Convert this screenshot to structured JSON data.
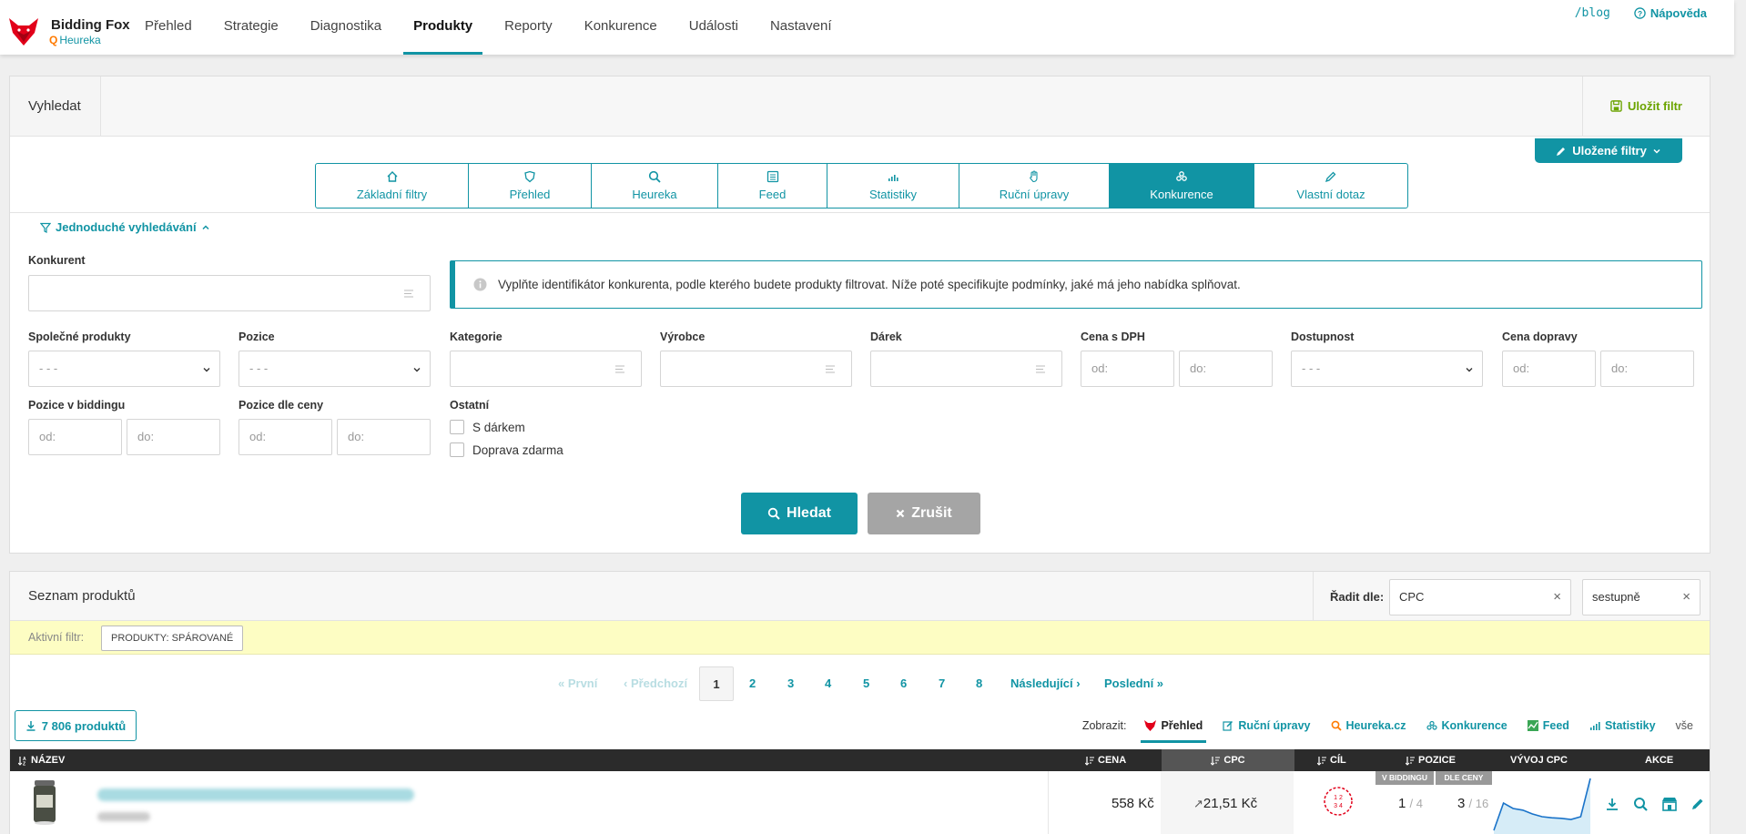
{
  "app": {
    "name": "Bidding Fox",
    "sub": "Heureka"
  },
  "nav": [
    {
      "label": "Přehled"
    },
    {
      "label": "Strategie"
    },
    {
      "label": "Diagnostika"
    },
    {
      "label": "Produkty"
    },
    {
      "label": "Reporty"
    },
    {
      "label": "Konkurence"
    },
    {
      "label": "Události"
    },
    {
      "label": "Nastavení"
    }
  ],
  "top_right": {
    "blog": "/blog",
    "help": "Nápověda"
  },
  "search": {
    "title": "Vyhledat",
    "save_filter": "Uložit filtr",
    "saved_filters": "Uložené filtry",
    "tabs": [
      {
        "label": "Základní filtry"
      },
      {
        "label": "Přehled"
      },
      {
        "label": "Heureka"
      },
      {
        "label": "Feed"
      },
      {
        "label": "Statistiky"
      },
      {
        "label": "Ruční úpravy"
      },
      {
        "label": "Konkurence"
      },
      {
        "label": "Vlastní dotaz"
      }
    ],
    "simple": "Jednoduché vyhledávání",
    "competitor_label": "Konkurent",
    "info": "Vyplňte identifikátor konkurenta, podle kterého budete produkty filtrovat. Níže poté specifikujte podmínky, jaké má jeho nabídka splňovat.",
    "labels": {
      "common": "Společné produkty",
      "position": "Pozice",
      "category": "Kategorie",
      "maker": "Výrobce",
      "gift": "Dárek",
      "price_vat": "Cena s DPH",
      "availability": "Dostupnost",
      "shipping": "Cena dopravy",
      "pos_bidding": "Pozice v biddingu",
      "pos_price": "Pozice dle ceny",
      "other": "Ostatní"
    },
    "select_placeholder": "- - -",
    "from": "od:",
    "to": "do:",
    "checkbox_gift": "S dárkem",
    "checkbox_free": "Doprava zdarma",
    "btn_search": "Hledat",
    "btn_cancel": "Zrušit"
  },
  "list": {
    "title": "Seznam produktů",
    "sort_label": "Řadit dle:",
    "sort_by": "CPC",
    "sort_dir": "sestupně",
    "active_filter_label": "Aktivní filtr:",
    "active_filter_tag": "PRODUKTY: SPÁROVANÉ",
    "pager": {
      "first": "První",
      "prev": "Předchozí",
      "pages": [
        "1",
        "2",
        "3",
        "4",
        "5",
        "6",
        "7",
        "8"
      ],
      "next": "Následující",
      "last": "Poslední"
    },
    "count": "7 806 produktů",
    "show_label": "Zobrazit:",
    "show": [
      "Přehled",
      "Ruční úpravy",
      "Heureka.cz",
      "Konkurence",
      "Feed",
      "Statistiky",
      "vše"
    ],
    "columns": {
      "name": "NÁZEV",
      "price": "CENA",
      "cpc": "CPC",
      "target": "CÍL",
      "position": "POZICE",
      "trend": "VÝVOJ CPC",
      "actions": "AKCE"
    },
    "subcolumns": {
      "bidding": "V BIDDINGU",
      "by_price": "DLE CENY"
    },
    "row": {
      "price": "558 Kč",
      "cpc": "21,51 Kč",
      "target_digits": "1 2 3 4",
      "pos_bidding": "1",
      "pos_bidding_total": "/ 4",
      "pos_price": "3",
      "pos_price_total": "/ 16",
      "cpc_trend": [
        0.05,
        0.55,
        0.45,
        0.42,
        0.35,
        0.3,
        0.28,
        0.27,
        0.25,
        0.3,
        1.0
      ]
    }
  },
  "colors": {
    "accent": "#1194a4",
    "save": "#6ba400",
    "orange": "#ff7a00",
    "red": "#e2001a"
  }
}
